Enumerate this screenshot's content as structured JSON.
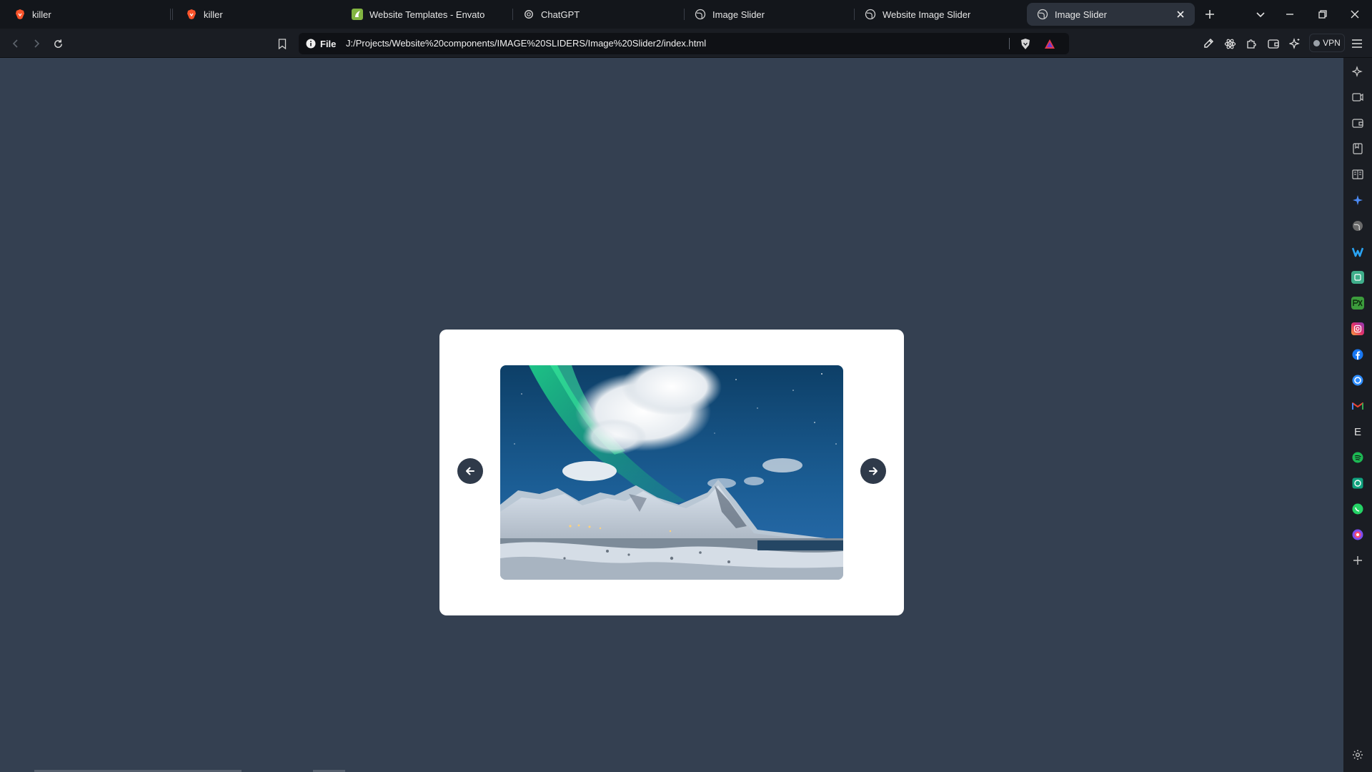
{
  "browser": {
    "tabs": [
      {
        "title": "killer",
        "icon": "brave-lion-icon"
      },
      {
        "title": "killer",
        "icon": "brave-lion-icon"
      },
      {
        "title": "Website Templates - Envato",
        "icon": "envato-icon"
      },
      {
        "title": "ChatGPT",
        "icon": "openai-icon"
      },
      {
        "title": "Image Slider",
        "icon": "globe-icon"
      },
      {
        "title": "Website Image Slider",
        "icon": "globe-icon"
      },
      {
        "title": "Image Slider",
        "icon": "globe-icon",
        "active": true
      }
    ],
    "address": {
      "scheme_label": "File",
      "url": "J:/Projects/Website%20components/IMAGE%20SLIDERS/Image%20Slider2/index.html"
    },
    "vpn_label": "VPN",
    "sidebar_letter": "E"
  },
  "page": {
    "background": "#344051",
    "card_color": "#ffffff",
    "arrow_color": "#2f3a4a",
    "slide_image": "aurora-over-snowy-mountains"
  },
  "colors": {
    "brave_red": "#fb542b",
    "envato_green": "#82b541",
    "accent_blue": "#4c8bf5"
  }
}
